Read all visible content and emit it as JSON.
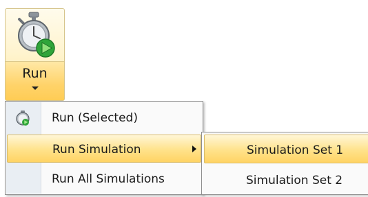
{
  "ribbon": {
    "run_label": "Run"
  },
  "menu": {
    "items": [
      {
        "label": "Run (Selected)",
        "icon": "stopwatch-icon"
      },
      {
        "label": "Run Simulation",
        "highlighted": true,
        "has_submenu": true
      },
      {
        "label": "Run All Simulations"
      }
    ]
  },
  "submenu": {
    "items": [
      {
        "label": "Simulation Set 1",
        "highlighted": true
      },
      {
        "label": "Simulation Set 2"
      }
    ]
  },
  "colors": {
    "highlight": "#ffe28a",
    "highlight_border": "#d9bb67",
    "menu_background": "#fafafa",
    "gutter": "#e9eef3",
    "play_green": "#2fa53a"
  }
}
